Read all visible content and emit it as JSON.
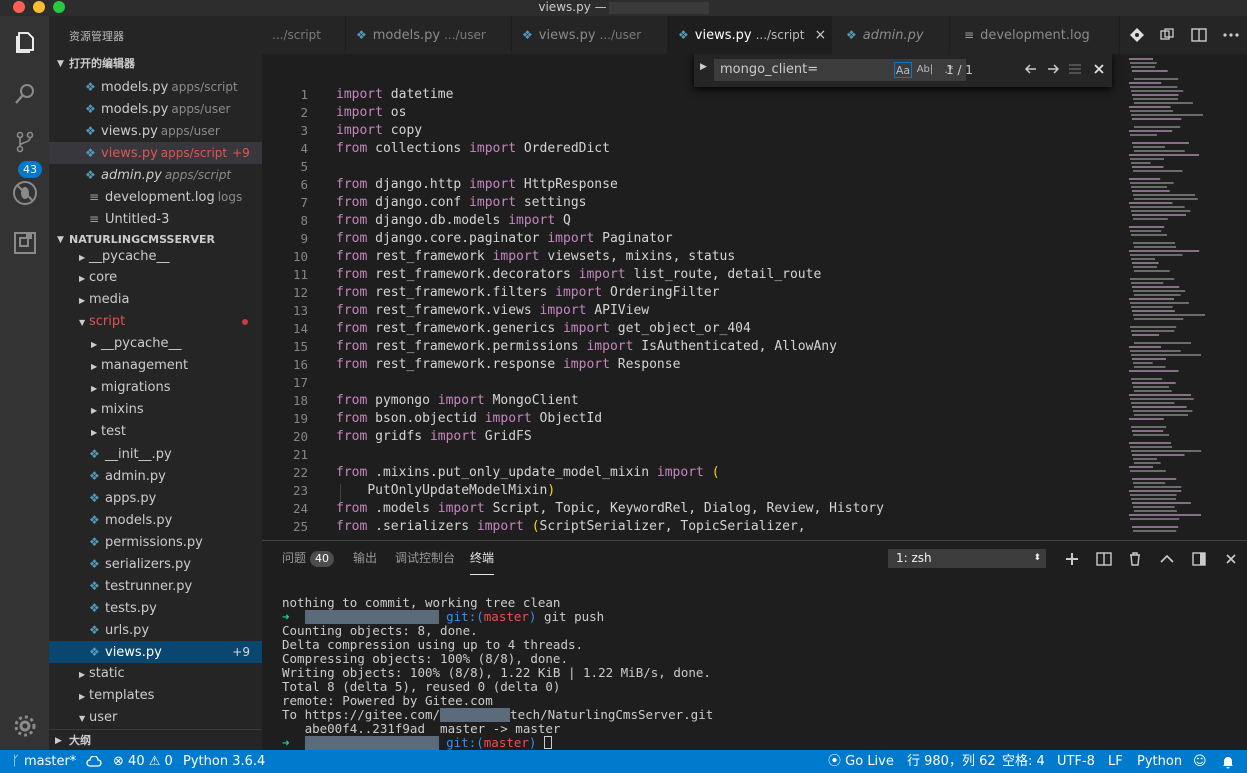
{
  "window": {
    "title": "views.py —"
  },
  "colors": {
    "accent": "#007acc",
    "modified": "#e2554f",
    "keyword": "#c586c0",
    "python_icon": "#519aba"
  },
  "activity": {
    "scm_badge": "43"
  },
  "sidebar": {
    "title": "资源管理器",
    "open_editors_header": "打开的编辑器",
    "open_editors": [
      {
        "name": "models.py",
        "path": "apps/script"
      },
      {
        "name": "models.py",
        "path": "apps/user"
      },
      {
        "name": "views.py",
        "path": "apps/user"
      },
      {
        "name": "views.py",
        "path": "apps/script",
        "badge": "+9"
      },
      {
        "name": "admin.py",
        "path": "apps/script"
      },
      {
        "name": "development.log",
        "path": "logs"
      },
      {
        "name": "Untitled-3",
        "path": ""
      }
    ],
    "project_header": "NATURLINGCMSSERVER",
    "tree": [
      "__pycache__",
      "core",
      "media",
      "script",
      "__pycache__",
      "management",
      "migrations",
      "mixins",
      "test",
      "__init__.py",
      "admin.py",
      "apps.py",
      "models.py",
      "permissions.py",
      "serializers.py",
      "testrunner.py",
      "tests.py",
      "urls.py",
      "views.py",
      "static",
      "templates",
      "user"
    ],
    "tree_badge": "+9",
    "outline_header": "大纲"
  },
  "tabs": [
    {
      "name": "",
      "path": ".../script"
    },
    {
      "name": "models.py",
      "path": ".../user"
    },
    {
      "name": "views.py",
      "path": ".../user"
    },
    {
      "name": "views.py",
      "path": ".../script",
      "close": "×"
    },
    {
      "name": "admin.py",
      "path": ""
    },
    {
      "name": "development.log",
      "path": ""
    }
  ],
  "find": {
    "value": "mongo_client=",
    "opt_case": "Aa",
    "opt_word": "Ab|",
    "opt_regex": ".*",
    "count": "1 / 1"
  },
  "editor": {
    "line_numbers": [
      "1",
      "2",
      "3",
      "4",
      "5",
      "6",
      "7",
      "8",
      "9",
      "10",
      "11",
      "12",
      "13",
      "14",
      "15",
      "16",
      "17",
      "18",
      "19",
      "20",
      "21",
      "22",
      "23",
      "24",
      "25"
    ],
    "lines": [
      "import datetime",
      "import os",
      "import copy",
      "from collections import OrderedDict",
      "",
      "from django.http import HttpResponse",
      "from django.conf import settings",
      "from django.db.models import Q",
      "from django.core.paginator import Paginator",
      "from rest_framework import viewsets, mixins, status",
      "from rest_framework.decorators import list_route, detail_route",
      "from rest_framework.filters import OrderingFilter",
      "from rest_framework.views import APIView",
      "from rest_framework.generics import get_object_or_404",
      "from rest_framework.permissions import IsAuthenticated, AllowAny",
      "from rest_framework.response import Response",
      "",
      "from pymongo import MongoClient",
      "from bson.objectid import ObjectId",
      "from gridfs import GridFS",
      "",
      "from .mixins.put_only_update_model_mixin import (",
      "    PutOnlyUpdateModelMixin)",
      "from .models import Script, Topic, KeywordRel, Dialog, Review, History",
      "from .serializers import (ScriptSerializer, TopicSerializer,"
    ]
  },
  "panel": {
    "tabs": [
      "问题",
      "输出",
      "调试控制台",
      "终端"
    ],
    "problems_count": "40",
    "terminal_select": "1: zsh",
    "terminal": {
      "l1": "nothing to commit, working tree clean",
      "prompt_arrow": "➜",
      "git_label": "git:(",
      "branch": "master",
      "git_close": ")",
      "cmd_push": "git push",
      "l3": "Counting objects: 8, done.",
      "l4": "Delta compression using up to 4 threads.",
      "l5": "Compressing objects: 100% (8/8), done.",
      "l6": "Writing objects: 100% (8/8), 1.22 KiB | 1.22 MiB/s, done.",
      "l7": "Total 8 (delta 5), reused 0 (delta 0)",
      "l8": "remote: Powered by Gitee.com",
      "l9a": "To https://gitee.com/",
      "l9b": "tech/NaturlingCmsServer.git",
      "l10": "   abe00f4..231f9ad  master -> master"
    }
  },
  "status": {
    "branch": "master*",
    "errors": "40",
    "warnings": "0",
    "python": "Python 3.6.4",
    "golive": "Go Live",
    "position": "行 980，列 62",
    "spaces": "空格: 4",
    "encoding": "UTF-8",
    "eol": "LF",
    "language": "Python"
  }
}
